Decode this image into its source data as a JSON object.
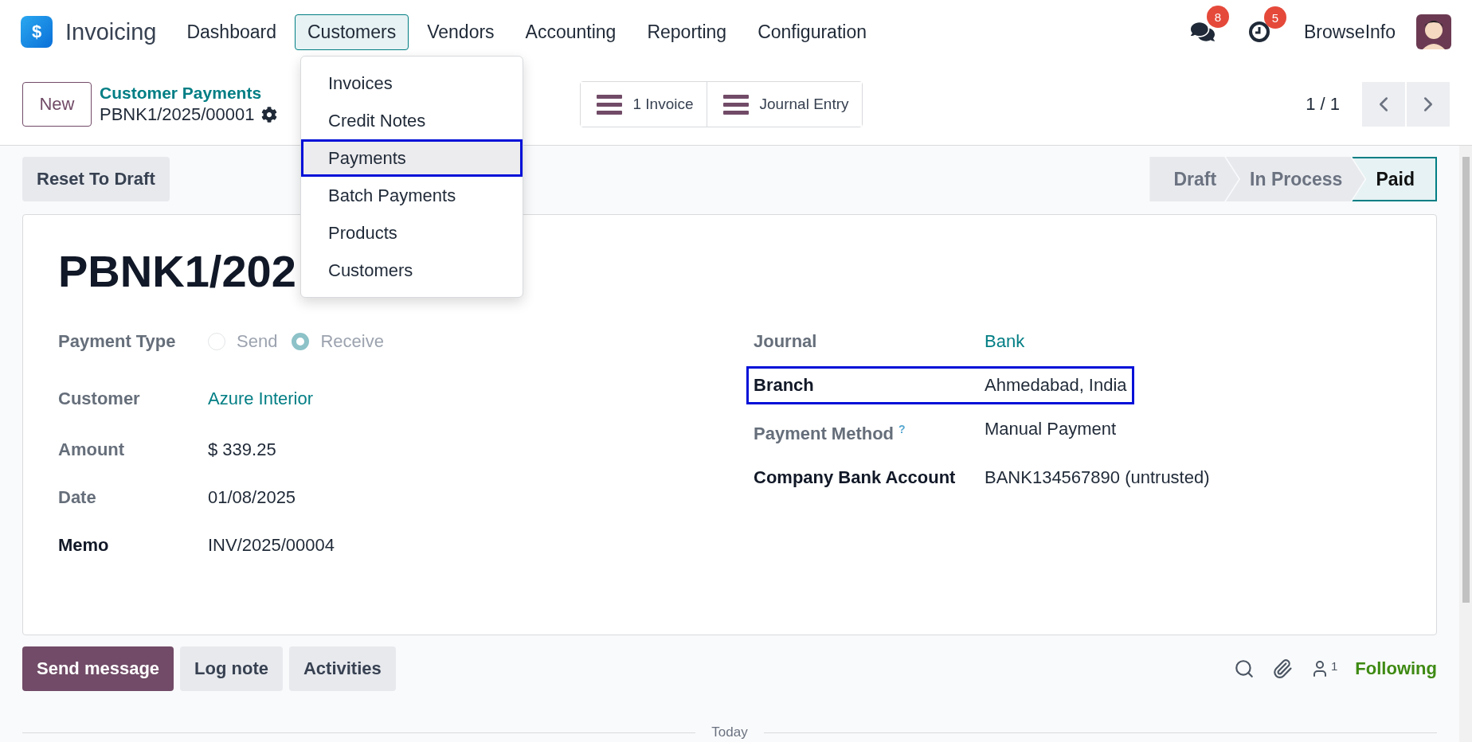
{
  "app": {
    "name": "Invoicing",
    "logo_symbol": "$"
  },
  "menu": [
    {
      "label": "Dashboard",
      "selected": false
    },
    {
      "label": "Customers",
      "selected": true
    },
    {
      "label": "Vendors",
      "selected": false
    },
    {
      "label": "Accounting",
      "selected": false
    },
    {
      "label": "Reporting",
      "selected": false
    },
    {
      "label": "Configuration",
      "selected": false
    }
  ],
  "dropdown": [
    {
      "label": "Invoices",
      "selected": false
    },
    {
      "label": "Credit Notes",
      "selected": false
    },
    {
      "label": "Payments",
      "selected": true
    },
    {
      "label": "Batch Payments",
      "selected": false
    },
    {
      "label": "Products",
      "selected": false
    },
    {
      "label": "Customers",
      "selected": false
    }
  ],
  "systray": {
    "messages_badge": "8",
    "activities_badge": "5",
    "user": "BrowseInfo"
  },
  "control_panel": {
    "new_button": "New",
    "breadcrumb": "Customer Payments",
    "record": "PBNK1/2025/00001",
    "smart_buttons": [
      "1 Invoice",
      "Journal Entry"
    ],
    "pager": "1 / 1"
  },
  "actions": [
    "Reset To Draft"
  ],
  "statusbar": [
    {
      "label": "Draft",
      "selected": false
    },
    {
      "label": "In Process",
      "selected": false
    },
    {
      "label": "Paid",
      "selected": true
    }
  ],
  "form": {
    "title": "PBNK1/202",
    "payment_type": {
      "label": "Payment Type",
      "options": [
        {
          "label": "Send",
          "selected": false
        },
        {
          "label": "Receive",
          "selected": true
        }
      ]
    },
    "left_fields": [
      {
        "label": "Customer",
        "value": "Azure Interior",
        "kind": "link",
        "required": false
      },
      {
        "label": "Amount",
        "value": "$ 339.25",
        "kind": "text",
        "required": false
      },
      {
        "label": "Date",
        "value": "01/08/2025",
        "kind": "text",
        "required": false
      },
      {
        "label": "Memo",
        "value": "INV/2025/00004",
        "kind": "text",
        "required": true
      }
    ],
    "right_fields": [
      {
        "label": "Journal",
        "value": "Bank",
        "kind": "link",
        "required": false,
        "highlighted": false
      },
      {
        "label": "Branch",
        "value": "Ahmedabad, India",
        "kind": "text",
        "required": true,
        "highlighted": true
      },
      {
        "label": "Payment Method",
        "help": "?",
        "value": "Manual Payment",
        "kind": "text",
        "required": false,
        "highlighted": false
      },
      {
        "label": "Company Bank Account",
        "value": "BANK134567890 (untrusted)",
        "kind": "text",
        "required": true,
        "highlighted": false
      }
    ]
  },
  "chatter": {
    "buttons": [
      {
        "label": "Send message",
        "kind": "primary"
      },
      {
        "label": "Log note",
        "kind": "secondary"
      },
      {
        "label": "Activities",
        "kind": "secondary"
      }
    ],
    "follower_count": "1",
    "following": "Following",
    "separator": "Today"
  }
}
